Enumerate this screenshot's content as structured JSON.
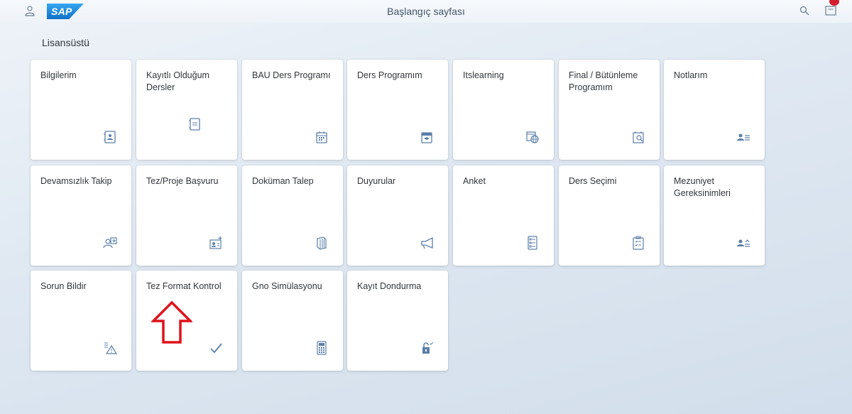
{
  "shell": {
    "logo_text": "SAP",
    "title": "Başlangıç sayfası"
  },
  "group": {
    "title": "Lisansüstü"
  },
  "tiles": [
    {
      "title": "Bilgilerim",
      "icon": "contact-card-icon"
    },
    {
      "title": "Kayıtlı Olduğum Dersler",
      "icon": "notebook-icon"
    },
    {
      "title": "BAU Ders Programı",
      "icon": "calendar-icon"
    },
    {
      "title": "Ders Programım",
      "icon": "education-calendar-icon"
    },
    {
      "title": "Itslearning",
      "icon": "web-calendar-icon"
    },
    {
      "title": "Final / Bütünleme Programım",
      "icon": "calendar-search-icon"
    },
    {
      "title": "Notlarım",
      "icon": "user-grades-icon"
    },
    {
      "title": "Devamsızlık Takip",
      "icon": "user-attendance-icon"
    },
    {
      "title": "Tez/Proje Başvuru",
      "icon": "add-contact-card-icon"
    },
    {
      "title": "Doküman Talep",
      "icon": "documents-icon"
    },
    {
      "title": "Duyurular",
      "icon": "megaphone-icon"
    },
    {
      "title": "Anket",
      "icon": "survey-icon"
    },
    {
      "title": "Ders Seçimi",
      "icon": "checklist-icon"
    },
    {
      "title": "Mezuniyet Gereksinimleri",
      "icon": "user-requirements-icon"
    },
    {
      "title": "Sorun Bildir",
      "icon": "report-alert-icon"
    },
    {
      "title": "Tez Format Kontrol",
      "icon": "checkmark-icon"
    },
    {
      "title": "Gno Simülasyonu",
      "icon": "calculator-icon"
    },
    {
      "title": "Kayıt Dondurma",
      "icon": "unlock-icon"
    }
  ],
  "colors": {
    "icon": "#5a7fa8",
    "annotation_arrow": "#e0121b",
    "notification_badge": "#d32030"
  }
}
